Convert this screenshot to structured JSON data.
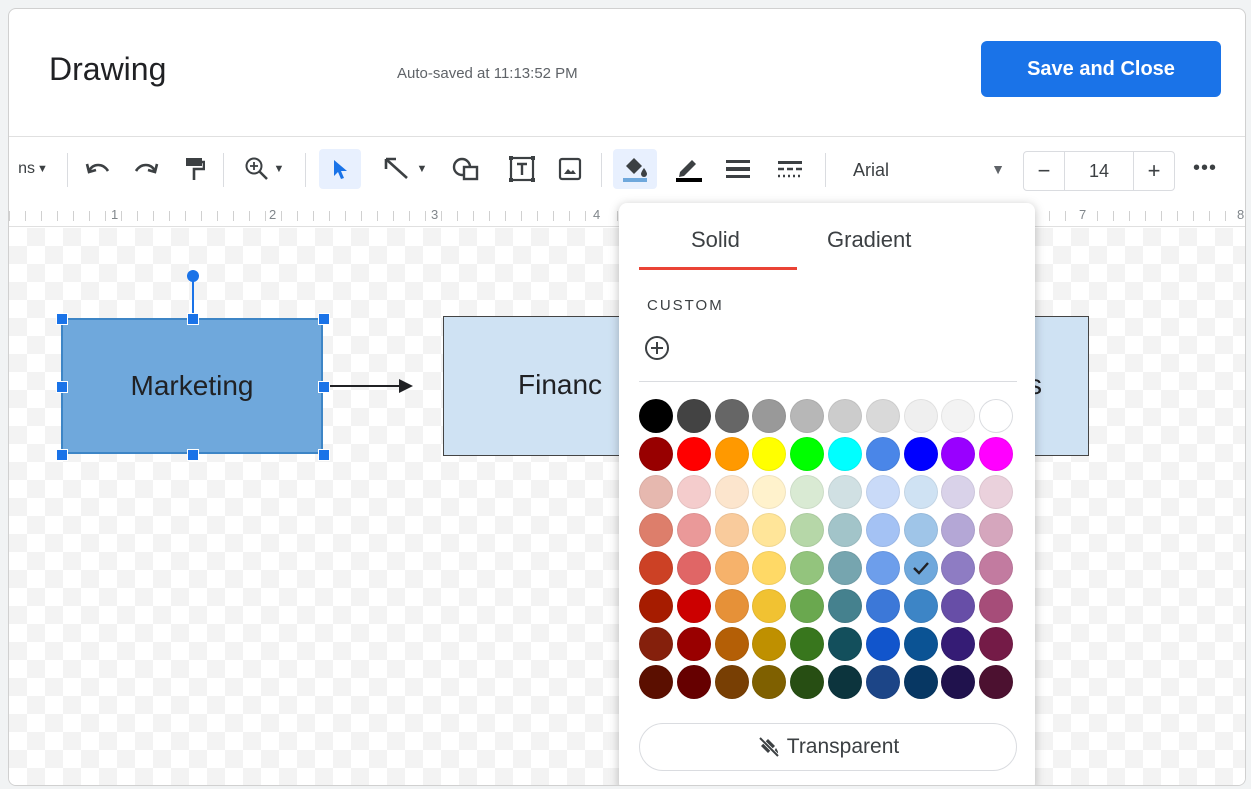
{
  "header": {
    "title": "Drawing",
    "autosave": "Auto-saved at 11:13:52 PM",
    "save_label": "Save and Close"
  },
  "toolbar": {
    "actions_partial": "ns",
    "font": "Arial",
    "font_size": "14",
    "minus": "−",
    "plus": "+",
    "more": "•••",
    "fill_color": "#6fa8dc",
    "line_color": "#000000"
  },
  "ruler": {
    "labels": [
      "1",
      "2",
      "3",
      "4",
      "7",
      "8"
    ]
  },
  "canvas": {
    "shape1_label": "Marketing",
    "shape2_label_visible": "Financ",
    "shape2_tail_visible": "s",
    "shape1_fill": "#6fa8dc",
    "shape2_fill": "#cfe2f3"
  },
  "palette": {
    "tab_solid": "Solid",
    "tab_gradient": "Gradient",
    "custom_label": "CUSTOM",
    "transparent_label": "Transparent",
    "selected": "#6fa8dc",
    "colors": [
      [
        "#000000",
        "#434343",
        "#666666",
        "#999999",
        "#b7b7b7",
        "#cccccc",
        "#d9d9d9",
        "#efefef",
        "#f3f3f3",
        "#ffffff"
      ],
      [
        "#980000",
        "#ff0000",
        "#ff9900",
        "#ffff00",
        "#00ff00",
        "#00ffff",
        "#4a86e8",
        "#0000ff",
        "#9900ff",
        "#ff00ff"
      ],
      [
        "#e6b8af",
        "#f4cccc",
        "#fce5cd",
        "#fff2cc",
        "#d9ead3",
        "#d0e0e3",
        "#c9daf8",
        "#cfe2f3",
        "#d9d2e9",
        "#ead1dc"
      ],
      [
        "#dd7e6b",
        "#ea9999",
        "#f9cb9c",
        "#ffe599",
        "#b6d7a8",
        "#a2c4c9",
        "#a4c2f4",
        "#9fc5e8",
        "#b4a7d6",
        "#d5a6bd"
      ],
      [
        "#cc4125",
        "#e06666",
        "#f6b26b",
        "#ffd966",
        "#93c47d",
        "#76a5af",
        "#6d9eeb",
        "#6fa8dc",
        "#8e7cc3",
        "#c27ba0"
      ],
      [
        "#a61c00",
        "#cc0000",
        "#e69138",
        "#f1c232",
        "#6aa84f",
        "#45818e",
        "#3c78d8",
        "#3d85c6",
        "#674ea7",
        "#a64d79"
      ],
      [
        "#85200c",
        "#990000",
        "#b45f06",
        "#bf9000",
        "#38761d",
        "#134f5c",
        "#1155cc",
        "#0b5394",
        "#351c75",
        "#741b47"
      ],
      [
        "#5b0f00",
        "#660000",
        "#783f04",
        "#7f6000",
        "#274e13",
        "#0c343d",
        "#1c4587",
        "#073763",
        "#20124d",
        "#4c1130"
      ]
    ]
  }
}
